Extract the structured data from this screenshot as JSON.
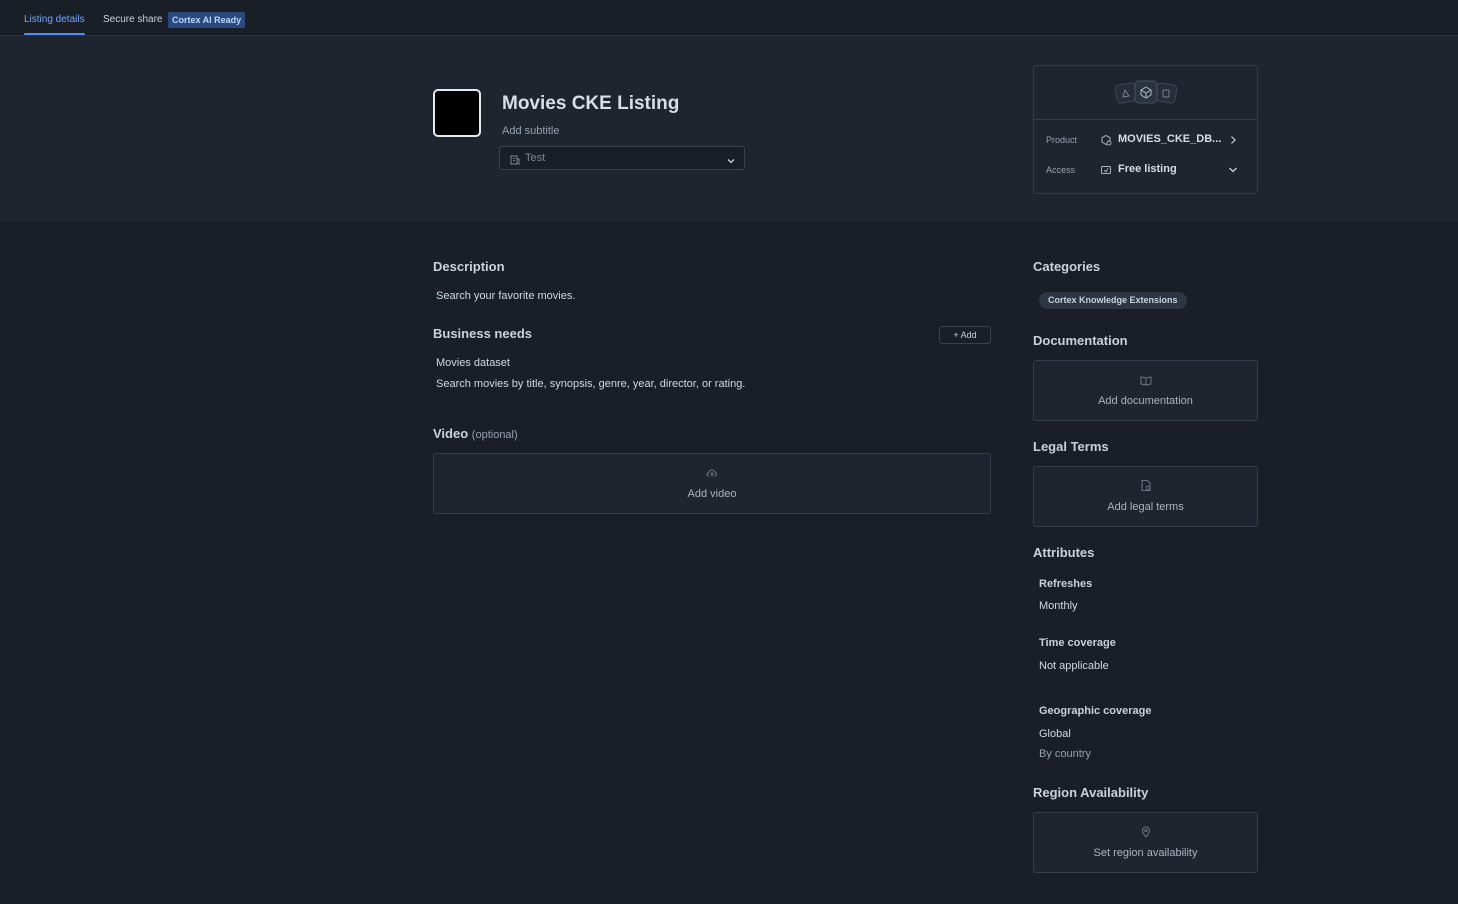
{
  "tabs": [
    {
      "label": "Listing details",
      "active": true
    },
    {
      "label": "Secure share",
      "active": false
    }
  ],
  "badge": "Cortex AI Ready",
  "header": {
    "title": "Movies CKE Listing",
    "subtitle_link": "Add subtitle",
    "select_value": "Test"
  },
  "product_card": {
    "product_label": "Product",
    "product_value": "MOVIES_CKE_DB...",
    "access_label": "Access",
    "access_value": "Free listing"
  },
  "description": {
    "heading": "Description",
    "text": "Search your favorite movies."
  },
  "business_needs": {
    "heading": "Business needs",
    "add_label": "Add",
    "title": "Movies dataset",
    "text": "Search movies by title, synopsis, genre, year, director, or rating."
  },
  "video": {
    "heading": "Video",
    "optional": "(optional)",
    "add_label": "Add video"
  },
  "categories": {
    "heading": "Categories",
    "chip": "Cortex Knowledge Extensions"
  },
  "documentation": {
    "heading": "Documentation",
    "add_label": "Add documentation"
  },
  "legal": {
    "heading": "Legal Terms",
    "add_label": "Add legal terms"
  },
  "attributes": {
    "heading": "Attributes",
    "refreshes_label": "Refreshes",
    "refreshes_value": "Monthly",
    "time_label": "Time coverage",
    "time_value": "Not applicable",
    "geo_label": "Geographic coverage",
    "geo_value": "Global",
    "geo_sub": "By country"
  },
  "region": {
    "heading": "Region Availability",
    "add_label": "Set region availability"
  },
  "colors": {
    "accent": "#4f8dff",
    "background": "#1a1f27",
    "panel": "#1f252e"
  }
}
